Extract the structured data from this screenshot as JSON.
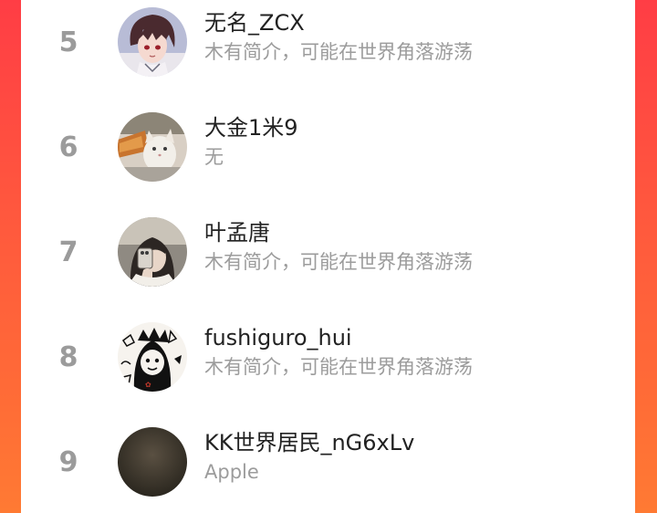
{
  "ranking": {
    "items": [
      {
        "rank": "5",
        "name": "无名_ZCX",
        "bio": "木有简介，可能在世界角落游荡",
        "avatar": "anime-character-avatar"
      },
      {
        "rank": "6",
        "name": "大金1米9",
        "bio": "无",
        "avatar": "cat-photo-avatar"
      },
      {
        "rank": "7",
        "name": "叶孟唐",
        "bio": "木有简介，可能在世界角落游荡",
        "avatar": "selfie-photo-avatar"
      },
      {
        "rank": "8",
        "name": "fushiguro_hui",
        "bio": "木有简介，可能在世界角落游荡",
        "avatar": "doodle-cartoon-avatar"
      },
      {
        "rank": "9",
        "name": "KK世界居民_nG6xLv",
        "bio": "Apple",
        "avatar": "dark-default-avatar"
      }
    ]
  },
  "colors": {
    "background_gradient_top": "#ff3d45",
    "background_gradient_bottom": "#ff7a33",
    "panel": "#ffffff",
    "rank_text": "#9b9b9b",
    "name_text": "#222222",
    "bio_text": "#9c9c9c"
  }
}
